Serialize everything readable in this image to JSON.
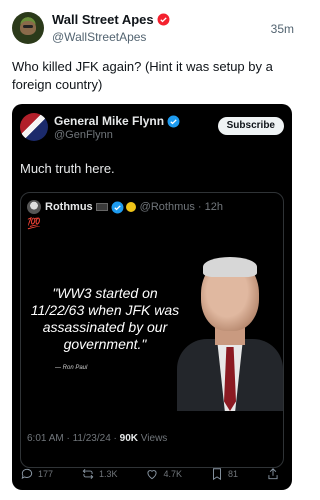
{
  "outer_tweet": {
    "display_name": "Wall Street Apes",
    "handle": "@WallStreetApes",
    "time": "35m",
    "text": "Who killed JFK again? (Hint it was setup by a foreign country)"
  },
  "quoted_tweet": {
    "display_name": "General Mike Flynn",
    "handle": "@GenFlynn",
    "subscribe_label": "Subscribe",
    "text": "Much truth here.",
    "inner_quote": {
      "display_name": "Rothmus",
      "handle": "@Rothmus",
      "time": "12h",
      "emoji": "💯",
      "image_quote": "\"WW3 started on 11/22/63 when JFK was assassinated by our government.\"",
      "image_attribution": "— Ron Paul"
    },
    "meta": {
      "timestamp": "6:01 AM · 11/23/24 ·",
      "views_count": "90K",
      "views_label": "Views"
    },
    "actions": {
      "replies": "177",
      "reposts": "1.3K",
      "likes": "4.7K",
      "bookmarks": "81"
    }
  },
  "colors": {
    "verified_blue": "#1d9bf0",
    "verified_red": "#f4212e",
    "quoted_background": "#000000"
  }
}
